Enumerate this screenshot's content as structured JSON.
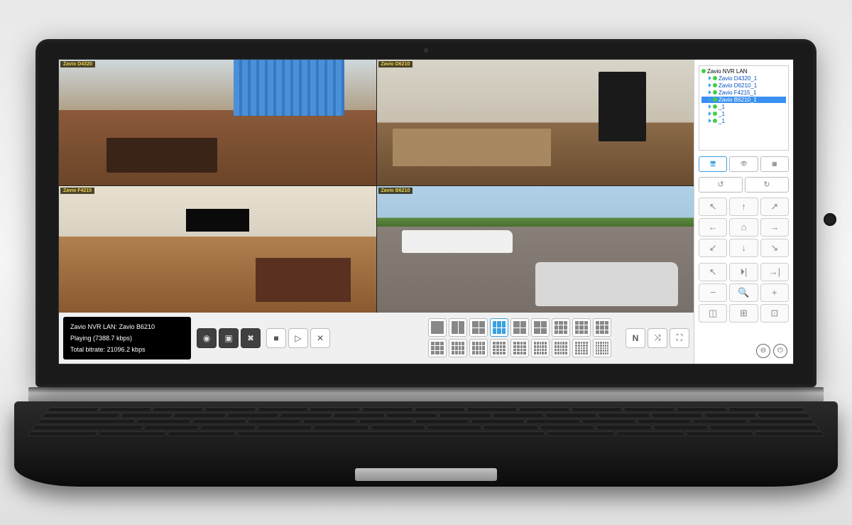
{
  "cameras": [
    {
      "label": "Zavio D4320"
    },
    {
      "label": "Zavio D6210"
    },
    {
      "label": "Zavio F4215"
    },
    {
      "label": "Zavio B6210"
    }
  ],
  "status": {
    "line1": "Zavio NVR LAN: Zavio B6210",
    "line2": "Playing (7388.7 kbps)",
    "line3": "Total bitrate: 21096.2 kbps"
  },
  "controls": {
    "record": "◉",
    "stopall": "▣",
    "settings": "✖",
    "stop": "■",
    "step": "▷",
    "close": "✕"
  },
  "layout_count": 18,
  "extra_btns": {
    "n": "N",
    "shuffle": "⤨",
    "fullscreen": "⛶"
  },
  "tree": {
    "root": "Zavio NVR LAN",
    "items": [
      {
        "label": "Zavio D4320_1",
        "selected": false
      },
      {
        "label": "Zavio D6210_1",
        "selected": false
      },
      {
        "label": "Zavio F4215_1",
        "selected": false
      },
      {
        "label": "Zavio B6210_1",
        "selected": true
      },
      {
        "label": "_1",
        "selected": false
      },
      {
        "label": "_1",
        "selected": false
      },
      {
        "label": "_1",
        "selected": false
      }
    ]
  },
  "side": {
    "tab_monitor": "🖥",
    "tab_eye": "👁",
    "tab_multi": "▦",
    "hand": "↺",
    "refresh": "↻",
    "ptz": {
      "ul": "↖",
      "u": "↑",
      "ur": "↗",
      "l": "←",
      "home": "⌂",
      "r": "→",
      "dl": "↙",
      "d": "↓",
      "dr": "↘"
    },
    "tool_row1": {
      "a": "↖",
      "b": "⏵|",
      "c": "→|"
    },
    "tool_row2": {
      "a": "−",
      "b": "🔍",
      "c": "+"
    },
    "tool_row3": {
      "a": "◫",
      "b": "⊞",
      "c": "⊡"
    },
    "minimize": "⊖",
    "power": "⏻"
  }
}
